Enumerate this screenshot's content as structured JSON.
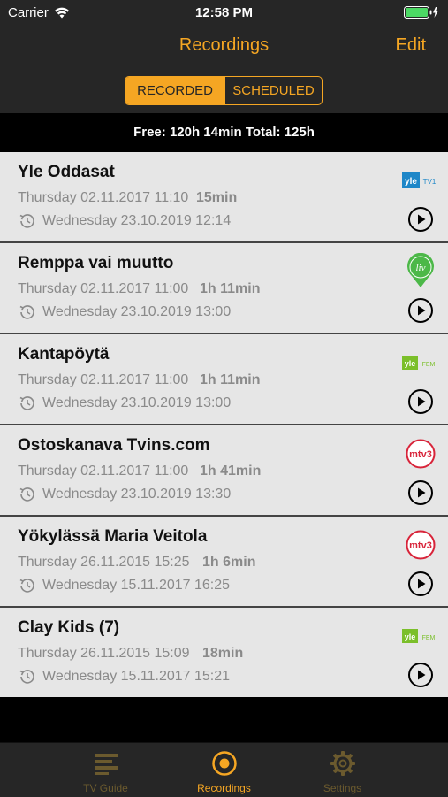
{
  "status": {
    "carrier": "Carrier",
    "time": "12:58 PM"
  },
  "nav": {
    "title": "Recordings",
    "edit": "Edit"
  },
  "segments": {
    "recorded": "RECORDED",
    "scheduled": "SCHEDULED",
    "selected": "RECORDED"
  },
  "storage": "Free: 120h 14min Total: 125h",
  "recordings": [
    {
      "title": "Yle Oddasat",
      "date": "Thursday 02.11.2017 11:10",
      "duration": "15min",
      "expires": "Wednesday 23.10.2019 12:14",
      "channel_logo": "yle-tv1-logo"
    },
    {
      "title": "Remppa vai muutto",
      "date": "Thursday 02.11.2017 11:00",
      "duration": "1h 11min",
      "expires": "Wednesday 23.10.2019 13:00",
      "channel_logo": "liv-logo"
    },
    {
      "title": "Kantapöytä",
      "date": "Thursday 02.11.2017 11:00",
      "duration": "1h 11min",
      "expires": "Wednesday 23.10.2019 13:00",
      "channel_logo": "yle-fem-logo"
    },
    {
      "title": "Ostoskanava Tvins.com",
      "date": "Thursday 02.11.2017 11:00",
      "duration": "1h 41min",
      "expires": "Wednesday 23.10.2019 13:30",
      "channel_logo": "mtv3-logo"
    },
    {
      "title": "Yökylässä Maria Veitola",
      "date": "Thursday 26.11.2015 15:25",
      "duration": "1h 6min",
      "expires": "Wednesday 15.11.2017 16:25",
      "channel_logo": "mtv3-logo"
    },
    {
      "title": "Clay Kids (7)",
      "date": "Thursday 26.11.2015 15:09",
      "duration": "18min",
      "expires": "Wednesday 15.11.2017 15:21",
      "channel_logo": "yle-fem-logo"
    }
  ],
  "logos": {
    "yle": "yle",
    "tv1": "TV1",
    "fem": "FEM",
    "liv": "liv",
    "mtv": "mtv3"
  },
  "tabs": [
    {
      "label": "TV Guide",
      "icon": "list-icon"
    },
    {
      "label": "Recordings",
      "icon": "record-icon"
    },
    {
      "label": "Settings",
      "icon": "gear-icon"
    }
  ],
  "colors": {
    "accent": "#f5a623",
    "bar": "#262626",
    "row_bg": "#e6e6e6",
    "yle_blue": "#1e87c8",
    "yle_green": "#7bbf2a",
    "mtv_red": "#d8243a",
    "liv_green": "#4cb848"
  }
}
